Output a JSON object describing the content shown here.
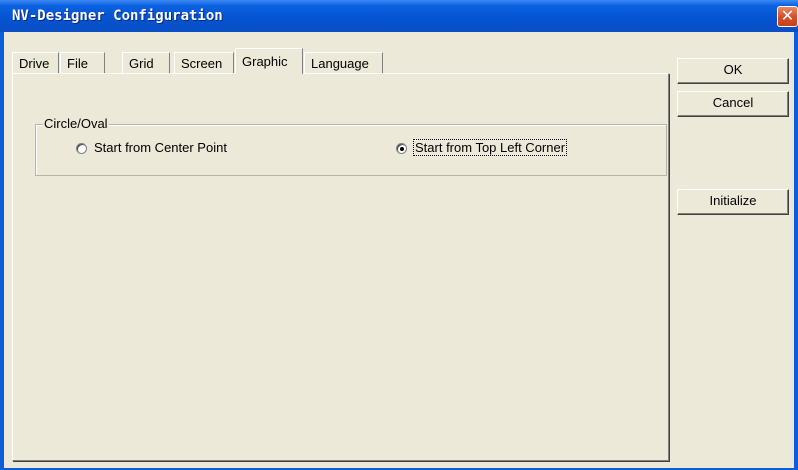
{
  "window": {
    "title": "NV-Designer Configuration",
    "close_glyph": "✕"
  },
  "tabs": [
    {
      "label": "Drive",
      "active": false
    },
    {
      "label": "File",
      "active": false
    },
    {
      "label": "Grid",
      "active": false
    },
    {
      "label": "Screen",
      "active": false
    },
    {
      "label": "Graphic",
      "active": true
    },
    {
      "label": "Language",
      "active": false
    }
  ],
  "graphic_panel": {
    "group_label": "Circle/Oval",
    "options": [
      {
        "label": "Start from Center Point",
        "checked": false
      },
      {
        "label": "Start from Top Left Corner",
        "checked": true
      }
    ]
  },
  "buttons": {
    "ok": "OK",
    "cancel": "Cancel",
    "initialize": "Initialize"
  },
  "colors": {
    "titlebar": "#0552d0",
    "dialog_background": "#ece9d8",
    "close_button": "#d8502a"
  }
}
